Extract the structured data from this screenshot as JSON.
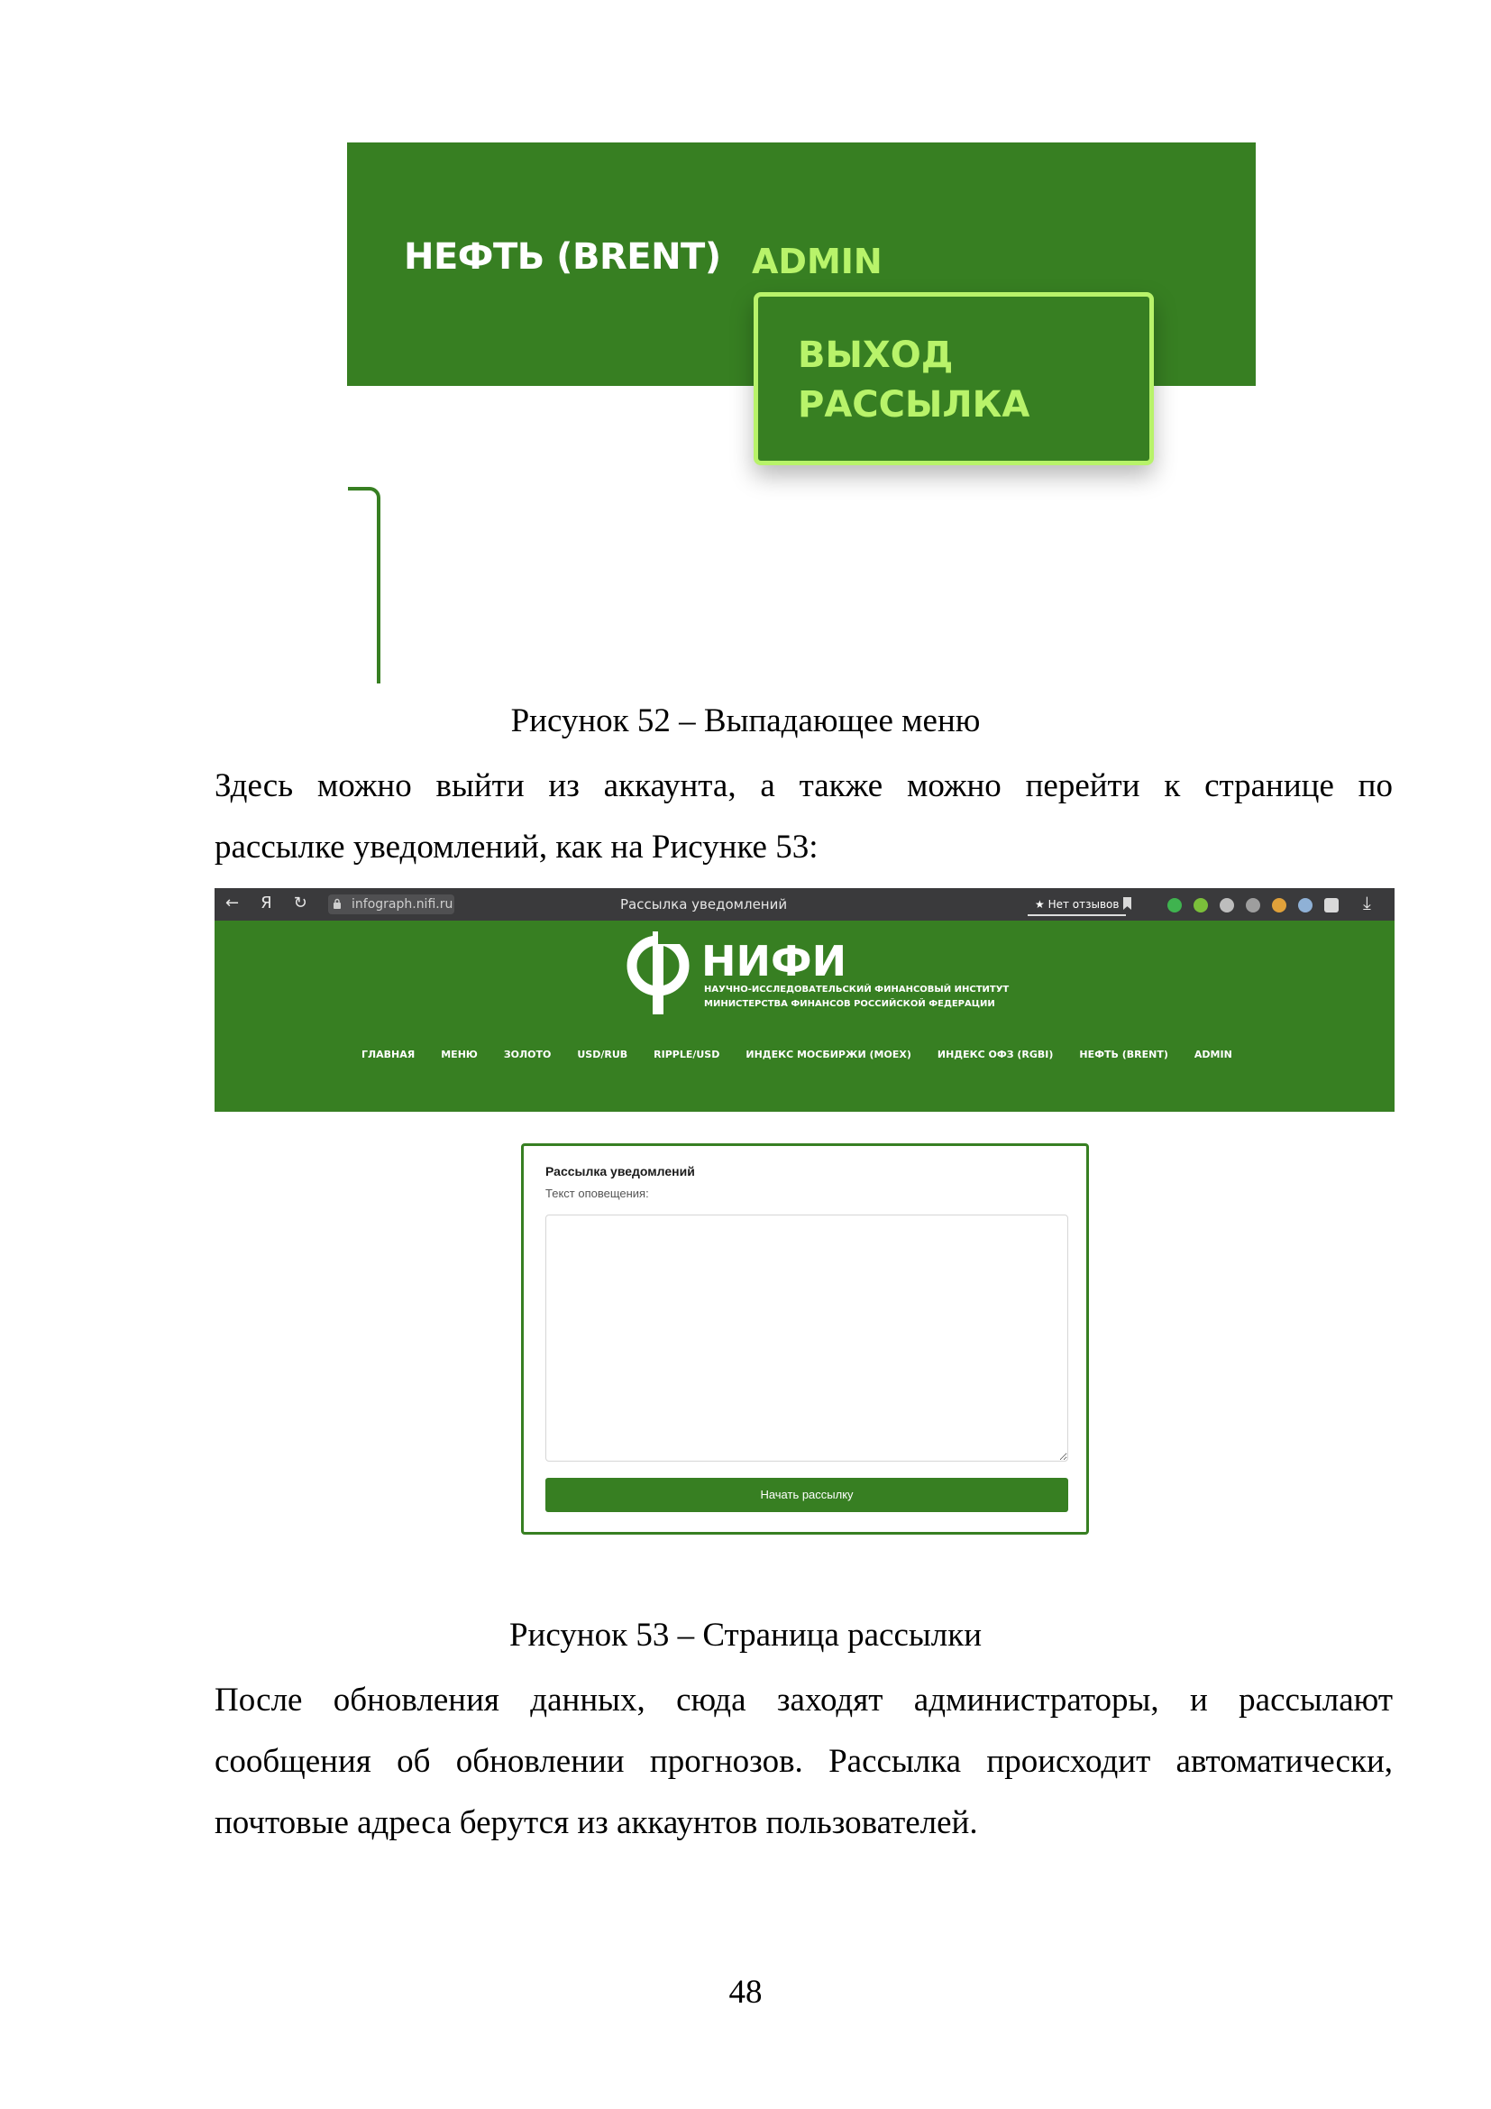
{
  "figure52": {
    "menu_item_oil": "НЕФТЬ (BRENT)",
    "menu_item_admin": "ADMIN",
    "dropdown_items": [
      "ВЫХОД",
      "РАССЫЛКА"
    ],
    "caption": "Рисунок 52 – Выпадающее меню",
    "colors": {
      "header_green": "#377f22",
      "accent_lime": "#b8f36a"
    }
  },
  "paragraph1": {
    "line1": "Здесь можно выйти из аккаунта, а также можно перейти к странице по",
    "line2": "рассылке уведомлений, как на Рисунке 53:"
  },
  "figure53": {
    "browser": {
      "nav_icons": [
        "arrow-left-icon",
        "yandex-icon",
        "reload-icon"
      ],
      "nav_glyphs": [
        "←",
        "Я",
        "↻"
      ],
      "url": "infograph.nifi.ru",
      "tab_title": "Рассылка уведомлений",
      "reviews_badge": "★ Нет отзывов",
      "download_glyph": "⤓"
    },
    "site": {
      "logo_name": "НИФИ",
      "logo_sub_line1": "НАУЧНО-ИССЛЕДОВАТЕЛЬСКИЙ ФИНАНСОВЫЙ ИНСТИТУТ",
      "logo_sub_line2": "МИНИСТЕРСТВА ФИНАНСОВ РОССИЙСКОЙ ФЕДЕРАЦИИ",
      "nav": [
        "ГЛАВНАЯ",
        "МЕНЮ",
        "ЗОЛОТО",
        "USD/RUB",
        "RIPPLE/USD",
        "ИНДЕКС МОСБИРЖИ (MOEX)",
        "ИНДЕКС ОФЗ (RGBI)",
        "НЕФТЬ (BRENT)",
        "ADMIN"
      ]
    },
    "form": {
      "title": "Рассылка уведомлений",
      "label": "Текст оповещения:",
      "textarea_value": "",
      "button": "Начать рассылку"
    },
    "caption": "Рисунок 53 – Страница рассылки"
  },
  "paragraph2": {
    "line1": "После обновления данных, сюда заходят администраторы, и рассылают",
    "line2": "сообщения об обновлении прогнозов. Рассылка происходит автоматически,",
    "line3": "почтовые адреса берутся из аккаунтов пользователей."
  },
  "page_number": "48"
}
